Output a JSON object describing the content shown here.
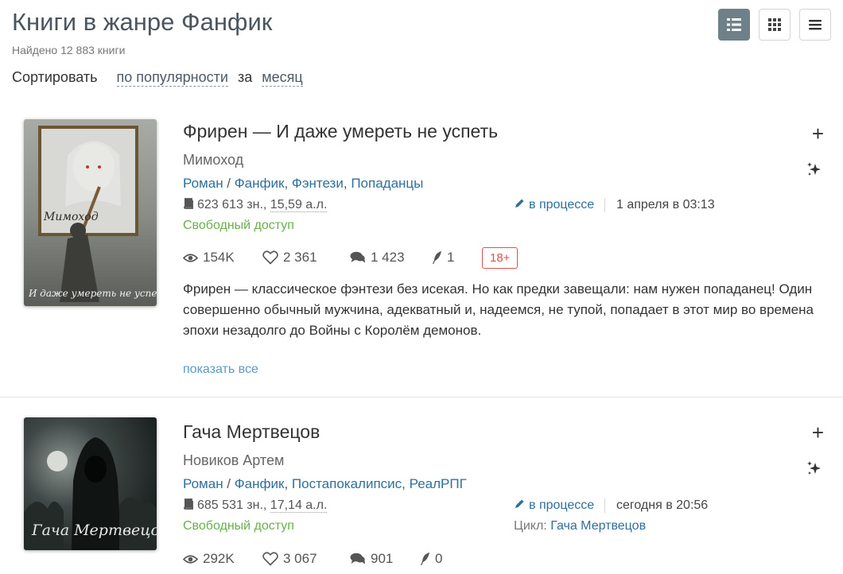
{
  "page": {
    "title": "Книги в жанре Фанфик",
    "found": "Найдено 12 883 книги",
    "sort_label": "Сортировать",
    "sort_value": "по популярности",
    "period_label": "за",
    "period_value": "месяц"
  },
  "view_buttons": [
    {
      "name": "list-view",
      "active": true
    },
    {
      "name": "grid-view",
      "active": false
    },
    {
      "name": "menu-view",
      "active": false
    }
  ],
  "books": [
    {
      "title": "Фрирен — И даже умереть не успеть",
      "author": "Мимоход",
      "genre_main": "Роман",
      "genres": [
        "Фанфик",
        "Фэнтези",
        "Попаданцы"
      ],
      "size_chars": "623 613 зн., ",
      "size_al": "15,59 а.л.",
      "status": "в процессе",
      "date": "1 апреля в 03:13",
      "access": "Свободный доступ",
      "views": "154K",
      "likes": "2 361",
      "comments": "1 423",
      "awards": "1",
      "age": "18+",
      "description": "Фрирен — классическое фэнтези без исекая. Но как предки завещали: нам нужен попаданец! Один совершенно обычный мужчина, адекватный и, надеемся, не тупой, попадает в этот мир во времена эпохи незадолго до Войны с Королём демонов.",
      "show_all": "показать все",
      "cover_author": "Мимоход",
      "cover_title": "И даже умереть не успеть"
    },
    {
      "title": "Гача Мертвецов",
      "author": "Новиков Артем",
      "genre_main": "Роман",
      "genres": [
        "Фанфик",
        "Постапокалипсис",
        "РеалРПГ"
      ],
      "size_chars": "685 531 зн., ",
      "size_al": "17,14 а.л.",
      "status": "в процессе",
      "date": "сегодня в 20:56",
      "access": "Свободный доступ",
      "cycle_label": "Цикл:",
      "cycle_value": "Гача Мертвецов",
      "views": "292K",
      "likes": "3 067",
      "comments": "901",
      "awards": "0",
      "cover_title": "Гача Мертвецов"
    }
  ],
  "colors": {
    "link": "#2f6f9c",
    "access": "#6ab04c",
    "age_badge": "#d9534f",
    "active_view": "#6f8089"
  }
}
